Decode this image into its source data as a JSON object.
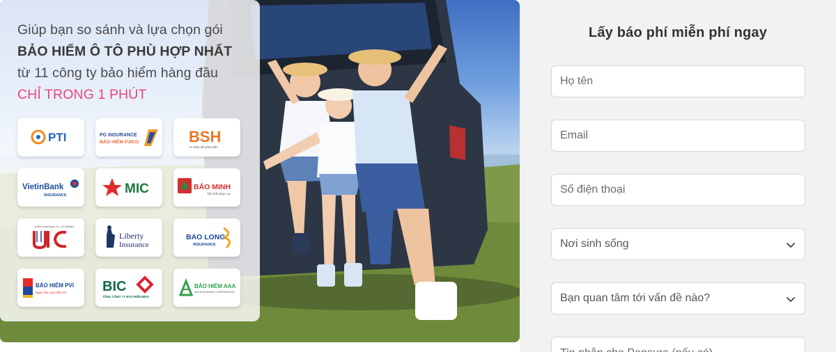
{
  "hero": {
    "line1": "Giúp bạn so sánh và lựa chọn gói",
    "line2": "BẢO HIỂM Ô TÔ PHÙ HỢP NHẤT",
    "line3": "từ 11 công ty bảo hiểm hàng đầu",
    "line4": "CHỈ TRONG 1 PHÚT"
  },
  "logos": {
    "pti": "PTI",
    "pjico_top": "PG INSURANCE",
    "pjico_bottom": "BẢO HIỂM PJICO",
    "bsh": "BSH",
    "bsh_tag": "An toàn để phát triển",
    "vietinbank": "VietinBank",
    "vietinbank_sub": "INSURANCE",
    "mic": "MIC",
    "baominh": "BẢO MINH",
    "baominh_tag": "Tận tình phục vụ",
    "uic_top": "United Insurance Co. of Vietnam",
    "liberty1": "Liberty",
    "liberty2": "Insurance",
    "baolong": "BAO LONG",
    "baolong_sub": "INSURANCE",
    "pvi": "BẢO HIỂM PVI",
    "pvi_tag": "Ngọn lửa của niềm tin",
    "bic": "BIC",
    "bic_sub": "TỔNG CÔNG TY BẢO HIỂM BIDV",
    "aaa": "BẢO HIỂM AAA",
    "aaa_sub": "AAA ASSURANCE CORPORATION"
  },
  "form": {
    "title": "Lấy báo phí miễn phí ngay",
    "name_placeholder": "Họ tên",
    "email_placeholder": "Email",
    "phone_placeholder": "Số điện thoại",
    "residence_value": "Nơi sinh sống",
    "concern_value": "Bạn quan tâm tới vấn đề nào?",
    "message_placeholder": "Tin nhắn cho Pansure (nếu có)"
  },
  "colors": {
    "accent_pink": "#e8477a",
    "form_bg": "#f2f2f2"
  }
}
